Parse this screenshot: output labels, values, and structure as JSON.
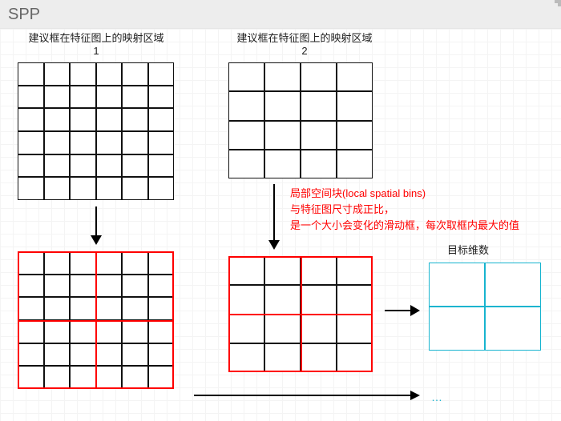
{
  "header": {
    "title": "SPP"
  },
  "captions": {
    "region1": "建议框在特征图上的映射区域\n1",
    "region2": "建议框在特征图上的映射区域\n2",
    "target_dim": "目标维数"
  },
  "annotation": {
    "line1": "局部空间块(local spatial bins)",
    "line2": "与特征图尺寸成正比，",
    "line3": "是一个大小会变化的滑动框，每次取框内最大的值"
  },
  "grids": {
    "topLeft": {
      "rows": 6,
      "cols": 6
    },
    "topRight": {
      "rows": 4,
      "cols": 4
    },
    "botLeft": {
      "rows": 6,
      "cols": 6,
      "overlay": "2x2"
    },
    "botMid": {
      "rows": 4,
      "cols": 4,
      "overlay": "2x2"
    },
    "target": {
      "rows": 2,
      "cols": 2,
      "style": "cyan"
    }
  },
  "ellipsis": "…"
}
